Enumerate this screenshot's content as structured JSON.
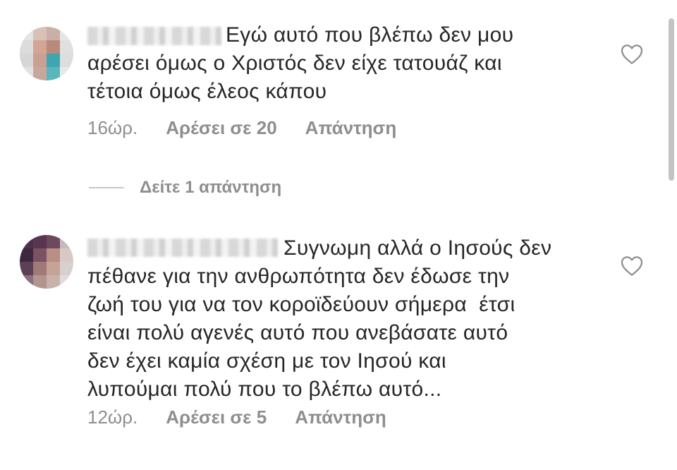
{
  "comments": [
    {
      "text": "Εγώ αυτό που βλέπω δεν μου\nαρέσει όμως ο Χριστός δεν είχε τατουάζ και\nτέτοια όμως έλεος κάπου",
      "time": "16ώρ.",
      "likes": "Αρέσει σε 20",
      "reply": "Απάντηση"
    },
    {
      "text": "Συγνωμη αλλά ο Ιησούς δεν\nπέθανε για την ανθρωπότητα δεν έδωσε την\nζωή του για να τον κοροϊδεύουν σήμερα  έτσι\nείναι πολύ αγενές αυτό που ανεβάσατε αυτό\nδεν έχει καμία σχέση με τον Ιησού και\nλυπούμαι πολύ που το βλέπω αυτό...",
      "time": "12ώρ.",
      "likes": "Αρέσει σε 5",
      "reply": "Απάντηση"
    }
  ],
  "view_replies": "Δείτε 1 απάντηση",
  "icons": {
    "like": "heart-outline-icon"
  },
  "colors": {
    "text": "#262626",
    "secondary": "#8e8e8e",
    "divider": "#c7c7c7"
  }
}
